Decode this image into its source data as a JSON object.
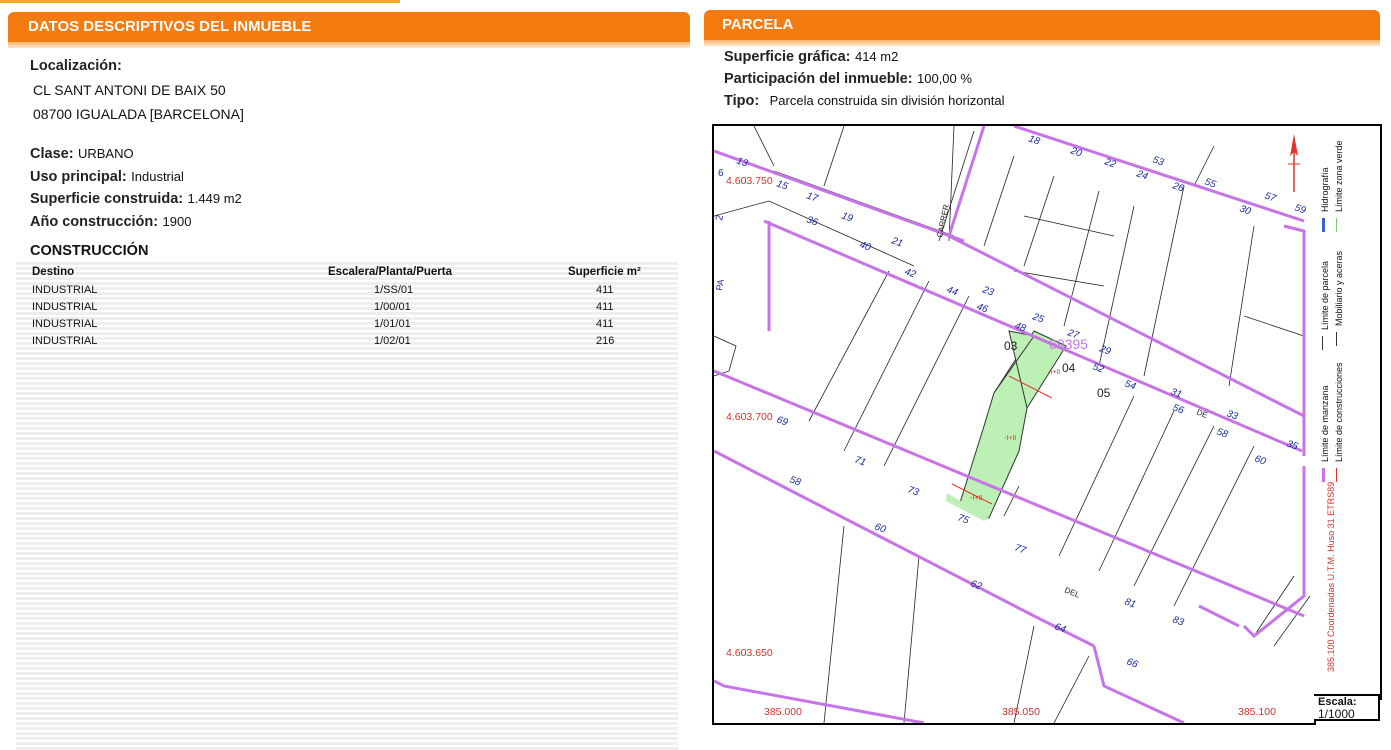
{
  "left": {
    "header": "DATOS DESCRIPTIVOS DEL INMUEBLE",
    "localizacion_label": "Localización:",
    "address_line1": "CL SANT ANTONI DE BAIX 50",
    "address_line2": "08700 IGUALADA [BARCELONA]",
    "clase_label": "Clase:",
    "clase_value": "URBANO",
    "uso_label": "Uso principal:",
    "uso_value": "Industrial",
    "superficie_label": "Superficie construida:",
    "superficie_value": "1.449 m2",
    "anio_label": "Año construcción:",
    "anio_value": "1900",
    "construccion_title": "CONSTRUCCIÓN",
    "table": {
      "headers": [
        "Destino",
        "Escalera/Planta/Puerta",
        "Superficie m²"
      ],
      "rows": [
        [
          "INDUSTRIAL",
          "1/SS/01",
          "411"
        ],
        [
          "INDUSTRIAL",
          "1/00/01",
          "411"
        ],
        [
          "INDUSTRIAL",
          "1/01/01",
          "411"
        ],
        [
          "INDUSTRIAL",
          "1/02/01",
          "216"
        ]
      ]
    }
  },
  "right": {
    "header": "PARCELA",
    "sup_label": "Superficie gráfica:",
    "sup_value": "414 m2",
    "part_label": "Participación del inmueble:",
    "part_value": "100,00 %",
    "tipo_label": "Tipo:",
    "tipo_value": "Parcela construida sin división horizontal"
  },
  "map": {
    "coords_y": [
      "4.603.750",
      "4.603.700",
      "4.603.650"
    ],
    "coords_x": [
      "385.000",
      "385.050",
      "385.100"
    ],
    "parcel_ref": "69395",
    "sub_parcels": [
      "03",
      "04",
      "05"
    ],
    "floor_labels": [
      "-I+II",
      "-I+II",
      "-I+II"
    ],
    "street_words": [
      "CARRER",
      "DE",
      "DEL"
    ],
    "house_numbers": [
      "13",
      "15",
      "17",
      "19",
      "21",
      "36",
      "40",
      "42",
      "44",
      "46",
      "48",
      "18",
      "20",
      "22",
      "24",
      "26",
      "53",
      "55",
      "57",
      "59",
      "30",
      "23",
      "25",
      "27",
      "29",
      "52",
      "54",
      "31",
      "56",
      "33",
      "58",
      "35",
      "60",
      "69",
      "71",
      "73",
      "75",
      "77",
      "58",
      "60",
      "62",
      "64",
      "66",
      "81",
      "83"
    ],
    "side_labels": [
      "6",
      "2",
      "PA"
    ]
  },
  "legend": {
    "items": [
      "Límite de manzana",
      "Límite de parcela",
      "Hidrografía",
      "Límite de construcciones",
      "Mobiliario y aceras",
      "Límite zona verde"
    ],
    "coords_note": "385.100 Coordenadas U.T.M. Huso 31 ETRS89",
    "colors": {
      "manzana": "#c774e8",
      "construcciones": "#e0342c",
      "parcela": "#333333",
      "hidrografia": "#3b5fd6",
      "zona_verde": "#7bd16b"
    }
  },
  "scale": {
    "label": "Escala:",
    "value": "1/1000"
  }
}
